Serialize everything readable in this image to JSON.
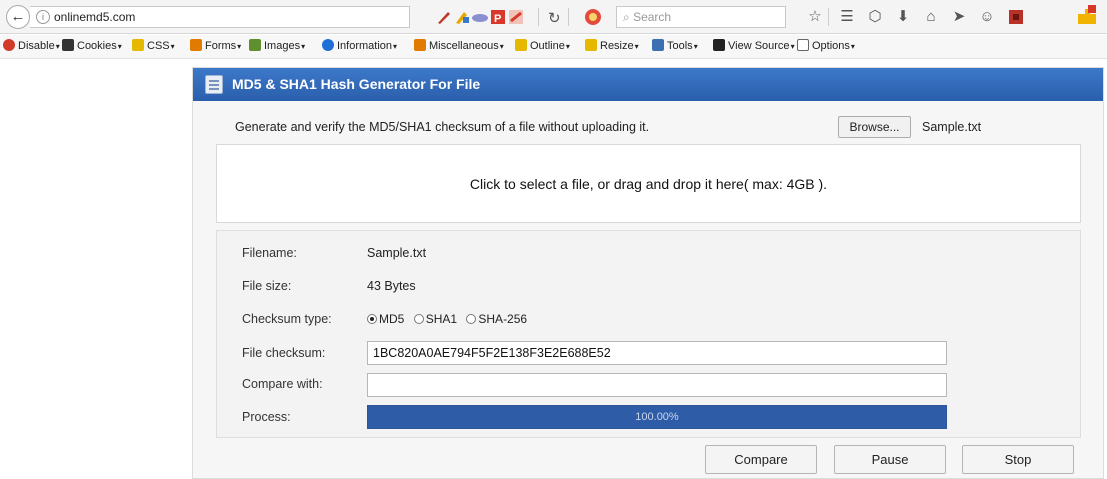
{
  "browser": {
    "url": "onlinemd5.com",
    "search_placeholder": "Search",
    "icons": [
      "back-icon",
      "info-icon",
      "reload-icon",
      "firebug-icon",
      "star-icon",
      "reading-list-icon",
      "pocket-icon",
      "download-icon",
      "home-icon",
      "send-icon",
      "emoji-icon",
      "addon-icon",
      "puzzle-icon"
    ]
  },
  "devtoolbar": {
    "items": [
      {
        "label": "Disable",
        "color": "#d23a2a"
      },
      {
        "label": "Cookies",
        "color": "#333333"
      },
      {
        "label": "CSS",
        "color": "#e6b800"
      },
      {
        "label": "Forms",
        "color": "#e07b00"
      },
      {
        "label": "Images",
        "color": "#5f8f2f"
      },
      {
        "label": "Information",
        "color": "#1e6fd6"
      },
      {
        "label": "Miscellaneous",
        "color": "#e07b00"
      },
      {
        "label": "Outline",
        "color": "#e6b800"
      },
      {
        "label": "Resize",
        "color": "#e6b800"
      },
      {
        "label": "Tools",
        "color": "#3d6fb3"
      },
      {
        "label": "View Source",
        "color": "#222222"
      },
      {
        "label": "Options",
        "color": "#666666"
      }
    ]
  },
  "app": {
    "title": "MD5 & SHA1 Hash Generator For File",
    "intro": "Generate and verify the MD5/SHA1 checksum of a file without uploading it.",
    "browse_label": "Browse...",
    "selected_file": "Sample.txt",
    "dropzone_text": "Click to select a file, or drag and drop it here( max: 4GB ).",
    "filename_label": "Filename:",
    "filename": "Sample.txt",
    "filesize_label": "File size:",
    "filesize": "43 Bytes",
    "checksum_type_label": "Checksum type:",
    "checksum_types": [
      {
        "label": "MD5",
        "checked": true
      },
      {
        "label": "SHA1",
        "checked": false
      },
      {
        "label": "SHA-256",
        "checked": false
      }
    ],
    "file_checksum_label": "File checksum:",
    "file_checksum": "1BC820A0AE794F5F2E138F3E2E688E52",
    "compare_label": "Compare with:",
    "compare_value": "",
    "process_label": "Process:",
    "progress_fraction": 1.0,
    "progress_text": "100.00%",
    "buttons": {
      "compare": "Compare",
      "pause": "Pause",
      "stop": "Stop"
    },
    "colors": {
      "header": "#2f66b3",
      "progress": "#2f5ca7"
    }
  }
}
